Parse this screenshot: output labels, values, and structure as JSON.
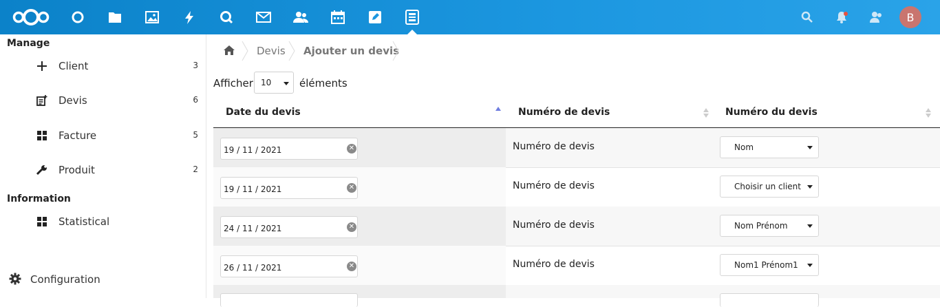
{
  "header": {
    "apps": [
      {
        "name": "dashboard-icon"
      },
      {
        "name": "files-icon"
      },
      {
        "name": "photos-icon"
      },
      {
        "name": "activity-icon"
      },
      {
        "name": "search-app-icon"
      },
      {
        "name": "mail-icon"
      },
      {
        "name": "contacts-icon"
      },
      {
        "name": "calendar-icon"
      },
      {
        "name": "notes-icon"
      },
      {
        "name": "gestion-icon"
      }
    ],
    "avatar_letter": "B",
    "accent": "#0082c9",
    "avatar_color": "#c9756f"
  },
  "sidebar": {
    "manage_title": "Manage",
    "items": [
      {
        "label": "Client",
        "count": "3",
        "icon": "plus-icon"
      },
      {
        "label": "Devis",
        "count": "6",
        "icon": "document-add-icon"
      },
      {
        "label": "Facture",
        "count": "5",
        "icon": "grid-icon"
      },
      {
        "label": "Produit",
        "count": "2",
        "icon": "wrench-icon"
      }
    ],
    "information_title": "Information",
    "info_items": [
      {
        "label": "Statistical",
        "icon": "grid-icon"
      }
    ],
    "config_label": "Configuration"
  },
  "breadcrumb": {
    "items": [
      "Devis",
      "Ajouter un devis"
    ]
  },
  "length": {
    "before": "Afficher",
    "value": "10",
    "after": "éléments"
  },
  "table": {
    "columns": [
      "Date du devis",
      "Numéro de devis",
      "Numéro du devis"
    ],
    "rows": [
      {
        "date": "19 / 11 / 2021",
        "numero": "Numéro de devis",
        "client": "Nom"
      },
      {
        "date": "19 / 11 / 2021",
        "numero": "Numéro de devis",
        "client": "Choisir un client"
      },
      {
        "date": "24 / 11 / 2021",
        "numero": "Numéro de devis",
        "client": "Nom Prénom"
      },
      {
        "date": "26 / 11 / 2021",
        "numero": "Numéro de devis",
        "client": "Nom1 Prénom1"
      }
    ]
  }
}
